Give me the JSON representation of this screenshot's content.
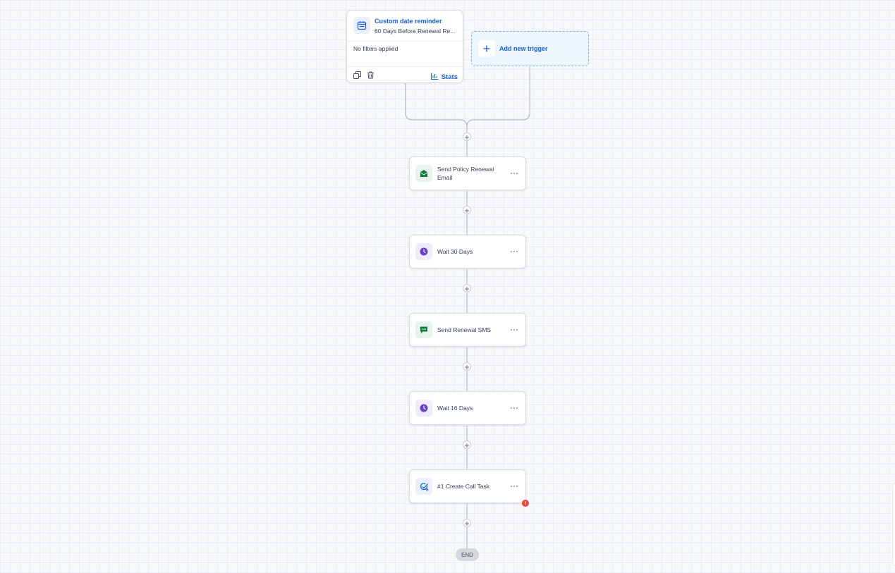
{
  "trigger": {
    "title": "Custom date reminder",
    "subtitle": "60 Days Before Renewal Re...",
    "filters": "No filters applied",
    "stats_label": "Stats",
    "icons": {
      "trigger": "calendar-icon",
      "copy": "copy-icon",
      "delete": "trash-icon",
      "stats": "bar-chart-icon"
    }
  },
  "add_trigger": {
    "label": "Add new trigger",
    "icon": "plus-icon"
  },
  "actions": [
    {
      "label": "Send Policy Renewal Email",
      "icon": "email-icon",
      "icon_color": "#0f7b3d"
    },
    {
      "label": "Wait 30 Days",
      "icon": "clock-icon",
      "icon_color": "#6941c6"
    },
    {
      "label": "Send Renewal SMS",
      "icon": "sms-icon",
      "icon_color": "#0f7b3d"
    },
    {
      "label": "Wait 16 Days",
      "icon": "clock-icon",
      "icon_color": "#6941c6"
    },
    {
      "label": "#1 Create Call Task",
      "icon": "task-icon",
      "icon_color": "#155eef",
      "has_error": true
    }
  ],
  "end_label": "END",
  "colors": {
    "accent": "#155eef",
    "error": "#f04438",
    "connector": "#a9b0ba"
  }
}
